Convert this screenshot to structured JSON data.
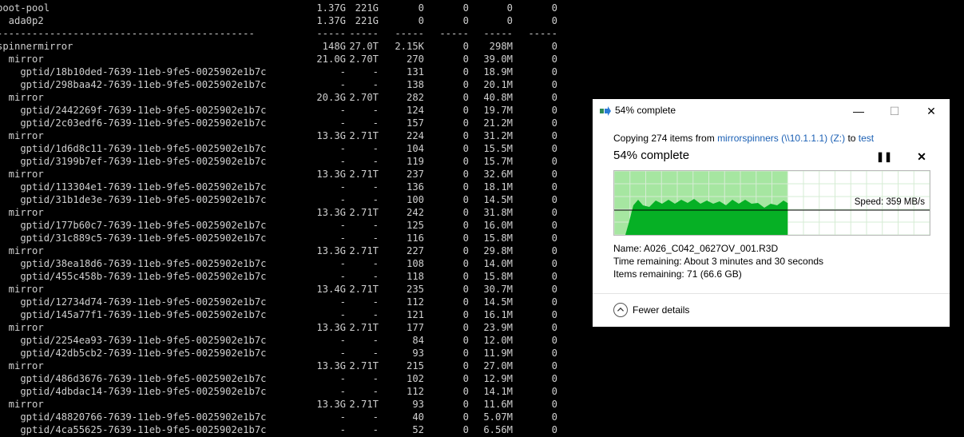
{
  "terminal": {
    "rows": [
      {
        "name": "boot-pool",
        "alloc": "1.37G",
        "free": "221G",
        "ops_r": "0",
        "ops_w": "0",
        "bw_r": "0",
        "bw_w": "0"
      },
      {
        "name": "  ada0p2",
        "alloc": "1.37G",
        "free": "221G",
        "ops_r": "0",
        "ops_w": "0",
        "bw_r": "0",
        "bw_w": "0"
      },
      {
        "name": "--------------------------------------------",
        "alloc": "-----",
        "free": "-----",
        "ops_r": "-----",
        "ops_w": "-----",
        "bw_r": "-----",
        "bw_w": "-----"
      },
      {
        "name": "spinnermirror",
        "alloc": "148G",
        "free": "27.0T",
        "ops_r": "2.15K",
        "ops_w": "0",
        "bw_r": "298M",
        "bw_w": "0"
      },
      {
        "name": "  mirror",
        "alloc": "21.0G",
        "free": "2.70T",
        "ops_r": "270",
        "ops_w": "0",
        "bw_r": "39.0M",
        "bw_w": "0"
      },
      {
        "name": "    gptid/18b10ded-7639-11eb-9fe5-0025902e1b7c",
        "alloc": "-",
        "free": "-",
        "ops_r": "131",
        "ops_w": "0",
        "bw_r": "18.9M",
        "bw_w": "0"
      },
      {
        "name": "    gptid/298baa42-7639-11eb-9fe5-0025902e1b7c",
        "alloc": "-",
        "free": "-",
        "ops_r": "138",
        "ops_w": "0",
        "bw_r": "20.1M",
        "bw_w": "0"
      },
      {
        "name": "  mirror",
        "alloc": "20.3G",
        "free": "2.70T",
        "ops_r": "282",
        "ops_w": "0",
        "bw_r": "40.8M",
        "bw_w": "0"
      },
      {
        "name": "    gptid/2442269f-7639-11eb-9fe5-0025902e1b7c",
        "alloc": "-",
        "free": "-",
        "ops_r": "124",
        "ops_w": "0",
        "bw_r": "19.7M",
        "bw_w": "0"
      },
      {
        "name": "    gptid/2c03edf6-7639-11eb-9fe5-0025902e1b7c",
        "alloc": "-",
        "free": "-",
        "ops_r": "157",
        "ops_w": "0",
        "bw_r": "21.2M",
        "bw_w": "0"
      },
      {
        "name": "  mirror",
        "alloc": "13.3G",
        "free": "2.71T",
        "ops_r": "224",
        "ops_w": "0",
        "bw_r": "31.2M",
        "bw_w": "0"
      },
      {
        "name": "    gptid/1d6d8c11-7639-11eb-9fe5-0025902e1b7c",
        "alloc": "-",
        "free": "-",
        "ops_r": "104",
        "ops_w": "0",
        "bw_r": "15.5M",
        "bw_w": "0"
      },
      {
        "name": "    gptid/3199b7ef-7639-11eb-9fe5-0025902e1b7c",
        "alloc": "-",
        "free": "-",
        "ops_r": "119",
        "ops_w": "0",
        "bw_r": "15.7M",
        "bw_w": "0"
      },
      {
        "name": "  mirror",
        "alloc": "13.3G",
        "free": "2.71T",
        "ops_r": "237",
        "ops_w": "0",
        "bw_r": "32.6M",
        "bw_w": "0"
      },
      {
        "name": "    gptid/113304e1-7639-11eb-9fe5-0025902e1b7c",
        "alloc": "-",
        "free": "-",
        "ops_r": "136",
        "ops_w": "0",
        "bw_r": "18.1M",
        "bw_w": "0"
      },
      {
        "name": "    gptid/31b1de3e-7639-11eb-9fe5-0025902e1b7c",
        "alloc": "-",
        "free": "-",
        "ops_r": "100",
        "ops_w": "0",
        "bw_r": "14.5M",
        "bw_w": "0"
      },
      {
        "name": "  mirror",
        "alloc": "13.3G",
        "free": "2.71T",
        "ops_r": "242",
        "ops_w": "0",
        "bw_r": "31.8M",
        "bw_w": "0"
      },
      {
        "name": "    gptid/177b60c7-7639-11eb-9fe5-0025902e1b7c",
        "alloc": "-",
        "free": "-",
        "ops_r": "125",
        "ops_w": "0",
        "bw_r": "16.0M",
        "bw_w": "0"
      },
      {
        "name": "    gptid/31c889c5-7639-11eb-9fe5-0025902e1b7c",
        "alloc": "-",
        "free": "-",
        "ops_r": "116",
        "ops_w": "0",
        "bw_r": "15.8M",
        "bw_w": "0"
      },
      {
        "name": "  mirror",
        "alloc": "13.3G",
        "free": "2.71T",
        "ops_r": "227",
        "ops_w": "0",
        "bw_r": "29.8M",
        "bw_w": "0"
      },
      {
        "name": "    gptid/38ea18d6-7639-11eb-9fe5-0025902e1b7c",
        "alloc": "-",
        "free": "-",
        "ops_r": "108",
        "ops_w": "0",
        "bw_r": "14.0M",
        "bw_w": "0"
      },
      {
        "name": "    gptid/455c458b-7639-11eb-9fe5-0025902e1b7c",
        "alloc": "-",
        "free": "-",
        "ops_r": "118",
        "ops_w": "0",
        "bw_r": "15.8M",
        "bw_w": "0"
      },
      {
        "name": "  mirror",
        "alloc": "13.4G",
        "free": "2.71T",
        "ops_r": "235",
        "ops_w": "0",
        "bw_r": "30.7M",
        "bw_w": "0"
      },
      {
        "name": "    gptid/12734d74-7639-11eb-9fe5-0025902e1b7c",
        "alloc": "-",
        "free": "-",
        "ops_r": "112",
        "ops_w": "0",
        "bw_r": "14.5M",
        "bw_w": "0"
      },
      {
        "name": "    gptid/145a77f1-7639-11eb-9fe5-0025902e1b7c",
        "alloc": "-",
        "free": "-",
        "ops_r": "121",
        "ops_w": "0",
        "bw_r": "16.1M",
        "bw_w": "0"
      },
      {
        "name": "  mirror",
        "alloc": "13.3G",
        "free": "2.71T",
        "ops_r": "177",
        "ops_w": "0",
        "bw_r": "23.9M",
        "bw_w": "0"
      },
      {
        "name": "    gptid/2254ea93-7639-11eb-9fe5-0025902e1b7c",
        "alloc": "-",
        "free": "-",
        "ops_r": "84",
        "ops_w": "0",
        "bw_r": "12.0M",
        "bw_w": "0"
      },
      {
        "name": "    gptid/42db5cb2-7639-11eb-9fe5-0025902e1b7c",
        "alloc": "-",
        "free": "-",
        "ops_r": "93",
        "ops_w": "0",
        "bw_r": "11.9M",
        "bw_w": "0"
      },
      {
        "name": "  mirror",
        "alloc": "13.3G",
        "free": "2.71T",
        "ops_r": "215",
        "ops_w": "0",
        "bw_r": "27.0M",
        "bw_w": "0"
      },
      {
        "name": "    gptid/486d3676-7639-11eb-9fe5-0025902e1b7c",
        "alloc": "-",
        "free": "-",
        "ops_r": "102",
        "ops_w": "0",
        "bw_r": "12.9M",
        "bw_w": "0"
      },
      {
        "name": "    gptid/4dbdac14-7639-11eb-9fe5-0025902e1b7c",
        "alloc": "-",
        "free": "-",
        "ops_r": "112",
        "ops_w": "0",
        "bw_r": "14.1M",
        "bw_w": "0"
      },
      {
        "name": "  mirror",
        "alloc": "13.3G",
        "free": "2.71T",
        "ops_r": "93",
        "ops_w": "0",
        "bw_r": "11.6M",
        "bw_w": "0"
      },
      {
        "name": "    gptid/48820766-7639-11eb-9fe5-0025902e1b7c",
        "alloc": "-",
        "free": "-",
        "ops_r": "40",
        "ops_w": "0",
        "bw_r": "5.07M",
        "bw_w": "0"
      },
      {
        "name": "    gptid/4ca55625-7639-11eb-9fe5-0025902e1b7c",
        "alloc": "-",
        "free": "-",
        "ops_r": "52",
        "ops_w": "0",
        "bw_r": "6.56M",
        "bw_w": "0"
      }
    ]
  },
  "dialog": {
    "title": "54% complete",
    "copying_prefix": "Copying 274 items from ",
    "source_link": "mirrorspinners (\\\\10.1.1.1) (Z:)",
    "to_text": " to ",
    "dest_link": "test",
    "percent_text": "54% complete",
    "progress": 0.55,
    "speed_text": "Speed: 359 MB/s",
    "name_line": "Name:  A026_C042_0627OV_001.R3D",
    "time_line": "Time remaining:  About 3 minutes and 30 seconds",
    "items_line": "Items remaining:  71 (66.6 GB)",
    "fewer_details": "Fewer details",
    "minimize_glyph": "—",
    "maximize_glyph": "☐",
    "close_glyph": "✕",
    "pause_glyph": "❚❚",
    "stop_glyph": "✕",
    "colors": {
      "progress_bg": "#a6e6a1",
      "fill": "#06b025",
      "link": "#1a5fb4"
    }
  }
}
